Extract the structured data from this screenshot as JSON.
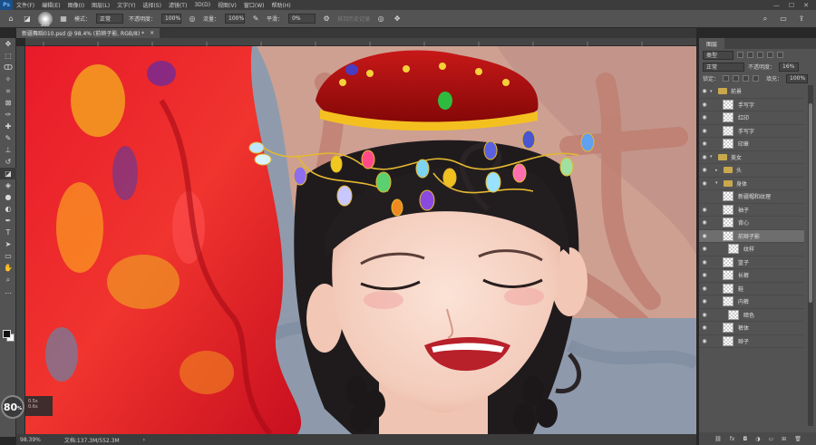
{
  "menu": [
    "文件(F)",
    "编辑(E)",
    "图像(I)",
    "图层(L)",
    "文字(Y)",
    "选择(S)",
    "滤镜(T)",
    "3D(D)",
    "视图(V)",
    "窗口(W)",
    "帮助(H)"
  ],
  "app_logo": "Ps",
  "options": {
    "brush_size": "200",
    "mode_label": "模式：",
    "mode_value": "正常",
    "opacity_label": "不透明度：",
    "opacity_value": "100%",
    "flow_label": "流量：",
    "flow_value": "100%",
    "smooth_label": "平滑：",
    "smooth_value": "0%",
    "history_label": "抹到历史记录"
  },
  "document_tab": {
    "title": "新疆舞蹈010.psd @ 98.4% (前辫子影, RGB/8) *",
    "close": "×"
  },
  "zoom_badge": {
    "value": "80",
    "unit": "%"
  },
  "navigator": {
    "line1": "0.5s",
    "line2": "0.6s"
  },
  "status": {
    "zoom": "98.39%",
    "doc": "文档:137.3M/552.3M"
  },
  "layers_panel": {
    "tab": "图层",
    "filter_label": "类型",
    "blend_mode": "正常",
    "opacity_label": "不透明度：",
    "opacity_value": "16%",
    "lock_label": "锁定：",
    "fill_label": "填充：",
    "fill_value": "100%",
    "layers": [
      {
        "name": "前景",
        "type": "group",
        "visible": true,
        "expanded": true,
        "indent": 0,
        "selected": false
      },
      {
        "name": "手写字",
        "type": "layer",
        "visible": true,
        "indent": 2,
        "selected": false
      },
      {
        "name": "红印",
        "type": "layer",
        "visible": true,
        "indent": 2,
        "selected": false
      },
      {
        "name": "手写字",
        "type": "layer",
        "visible": true,
        "indent": 2,
        "selected": false
      },
      {
        "name": "印章",
        "type": "layer",
        "visible": true,
        "indent": 2,
        "selected": false
      },
      {
        "name": "美女",
        "type": "group",
        "visible": true,
        "expanded": true,
        "indent": 0,
        "selected": false
      },
      {
        "name": "头",
        "type": "group",
        "visible": true,
        "expanded": false,
        "indent": 1,
        "selected": false
      },
      {
        "name": "身体",
        "type": "group",
        "visible": true,
        "expanded": true,
        "indent": 1,
        "selected": false
      },
      {
        "name": "新疆帽和纹理",
        "type": "layer",
        "visible": false,
        "indent": 2,
        "selected": false
      },
      {
        "name": "袖子",
        "type": "layer",
        "visible": true,
        "indent": 2,
        "selected": false
      },
      {
        "name": "背心",
        "type": "layer",
        "visible": true,
        "indent": 2,
        "selected": false
      },
      {
        "name": "前辫子影",
        "type": "layer",
        "visible": true,
        "indent": 2,
        "selected": true
      },
      {
        "name": "纹样",
        "type": "layer",
        "visible": true,
        "indent": 3,
        "selected": false
      },
      {
        "name": "篮子",
        "type": "layer",
        "visible": true,
        "indent": 2,
        "selected": false
      },
      {
        "name": "长裤",
        "type": "layer",
        "visible": true,
        "indent": 2,
        "selected": false
      },
      {
        "name": "鞋",
        "type": "layer",
        "visible": true,
        "indent": 2,
        "selected": false
      },
      {
        "name": "内裤",
        "type": "layer",
        "visible": true,
        "indent": 2,
        "selected": false
      },
      {
        "name": "暗色",
        "type": "layer",
        "visible": true,
        "indent": 3,
        "selected": false
      },
      {
        "name": "裤体",
        "type": "layer",
        "visible": true,
        "indent": 2,
        "selected": false
      },
      {
        "name": "辫子",
        "type": "layer",
        "visible": true,
        "indent": 2,
        "selected": false
      }
    ]
  },
  "colors": {
    "accent": "#1b4f88",
    "panel": "#535353",
    "dark": "#3c3c3c",
    "selected": "#6e6e6e"
  }
}
